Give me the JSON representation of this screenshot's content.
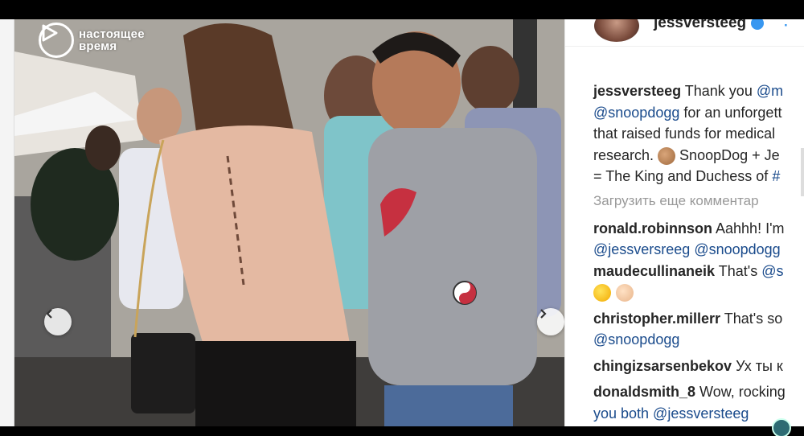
{
  "overlay": {
    "logo_line1": "настоящее",
    "logo_line2": "время"
  },
  "instagram": {
    "username": "jessversteeg",
    "follow_label": "·",
    "caption": {
      "username": "jessversteeg",
      "lines": [
        {
          "pre": "Thank you ",
          "mention": "@m",
          "post": ""
        },
        {
          "pre": "",
          "mention": "@snoopdogg",
          "post": " for an unforgett"
        },
        {
          "pre": "that raised funds for medical",
          "mention": "",
          "post": ""
        },
        {
          "pre": "research. ",
          "mention": "",
          "post": " SnoopDog + Je"
        },
        {
          "pre": "= The King and Duchess of ",
          "mention": "#",
          "post": ""
        }
      ]
    },
    "load_more_label": "Загрузить еще комментар",
    "comments": [
      {
        "username": "ronald.robinnson",
        "text": "Aahhh! I'm",
        "line2": "@jessversreeg @snoopdogg"
      },
      {
        "username": "maudecullinaneik",
        "text": "That's ",
        "mention": "@s"
      },
      {
        "username": "christopher.millerr",
        "text": "That's so",
        "line2": "@snoopdogg"
      },
      {
        "username": "chingizsarsenbekov",
        "text": "Ух ты к"
      },
      {
        "username": "donaldsmith_8",
        "text": "Wow, rocking",
        "line2": "you both @jessversteeg"
      }
    ]
  },
  "colors": {
    "mention": "#1a4b8c",
    "verified": "#3897f0",
    "text": "#262626"
  },
  "icons": {
    "prev": "chevron-left-icon",
    "next": "chevron-right-icon",
    "logo": "play-logo-icon"
  }
}
